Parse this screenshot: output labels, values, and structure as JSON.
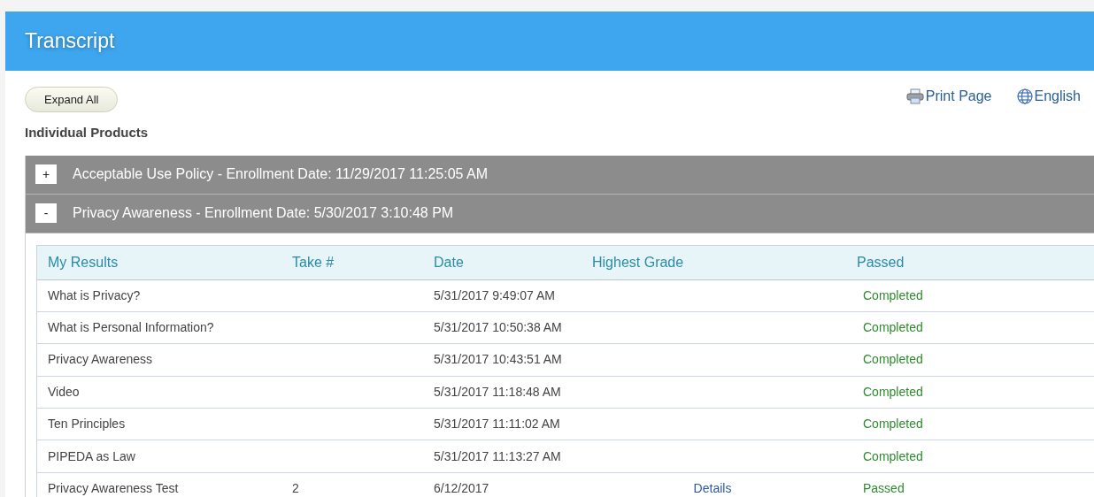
{
  "header": {
    "title": "Transcript"
  },
  "toolbar": {
    "expand_button": "Expand All",
    "links": [
      {
        "kind": "print",
        "label": "Print Page"
      },
      {
        "kind": "language",
        "label": "English"
      }
    ]
  },
  "section_title": "Individual Products",
  "products": [
    {
      "toggle": "+",
      "title": "Acceptable Use Policy - Enrollment Date: 11/29/2017 11:25:05 AM"
    },
    {
      "toggle": "-",
      "title": "Privacy Awareness - Enrollment Date: 5/30/2017 3:10:48 PM",
      "table": {
        "columns": [
          "My Results",
          "Take #",
          "Date",
          "Highest Grade",
          "Passed"
        ],
        "rows": [
          {
            "name": "What is Privacy?",
            "date": "5/31/2017 9:49:07 AM",
            "status": "Completed"
          },
          {
            "name": "What is Personal Information?",
            "date": "5/31/2017 10:50:38 AM",
            "status": "Completed"
          },
          {
            "name": "Privacy Awareness",
            "date": "5/31/2017 10:43:51 AM",
            "status": "Completed"
          },
          {
            "name": "Video",
            "date": "5/31/2017 11:18:48 AM",
            "status": "Completed"
          },
          {
            "name": "Ten Principles",
            "date": "5/31/2017 11:11:02 AM",
            "status": "Completed"
          },
          {
            "name": "PIPEDA as Law",
            "date": "5/31/2017 11:13:27 AM",
            "status": "Completed"
          },
          {
            "name": "Privacy Awareness Test",
            "take": "2",
            "date": "6/12/2017",
            "grade_link": "Details",
            "status": "Passed"
          }
        ]
      }
    }
  ]
}
